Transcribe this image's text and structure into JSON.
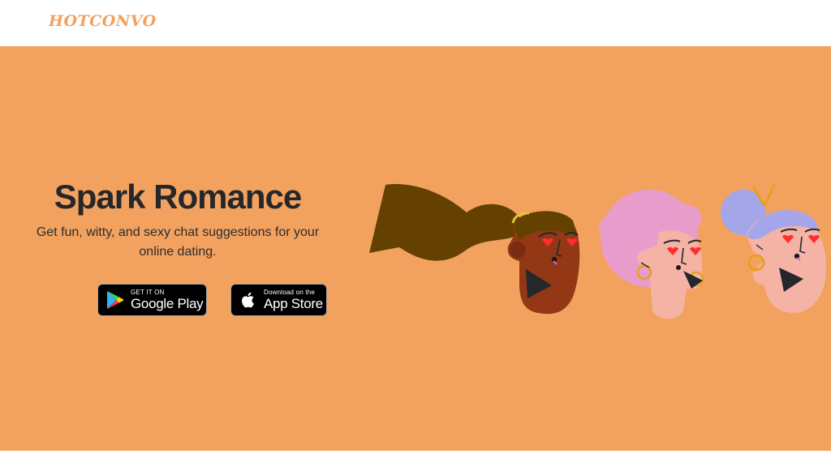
{
  "header": {
    "logo": "HOTCONVO"
  },
  "hero": {
    "headline": "Spark Romance",
    "subtitle": "Get fun, witty, and sexy chat suggestions for your online dating."
  },
  "store_buttons": {
    "google": {
      "small": "GET IT ON",
      "big": "Google Play",
      "icon": "google-play-icon"
    },
    "apple": {
      "small": "Download on the",
      "big": "App Store",
      "icon": "apple-icon"
    }
  },
  "colors": {
    "hero_background": "#f2a25e",
    "logo": "#f3a15c",
    "headline": "#25272b",
    "button_background": "#000000"
  },
  "illustration": {
    "description_icon": "three-faces-in-love-illustration"
  }
}
